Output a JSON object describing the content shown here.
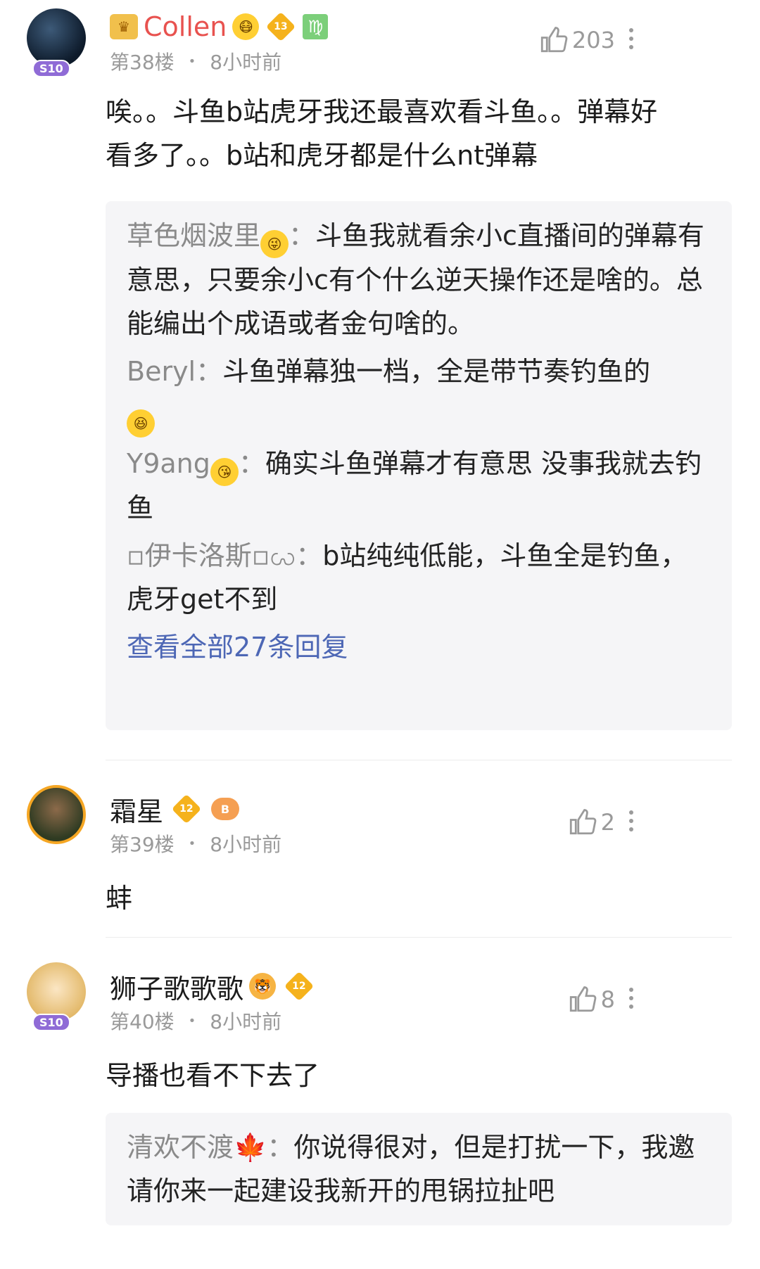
{
  "comments": [
    {
      "user": "Collen",
      "floor": "第38楼",
      "time": "8小时前",
      "likes": "203",
      "level": "13",
      "avatar_badge": "S10",
      "text": "唉。。斗鱼b站虎牙我还最喜欢看斗鱼。。弹幕好看多了。。b站和虎牙都是什么nt弹幕",
      "replies": [
        {
          "name": "草色烟波里",
          "text": "斗鱼我就看余小c直播间的弹幕有意思，只要余小c有个什么逆天操作还是啥的。总能编出个成语或者金句啥的。"
        },
        {
          "name": "Beryl",
          "text": "斗鱼弹幕独一档，全是带节奏钓鱼的"
        },
        {
          "name": "Y9ang",
          "text": "确实斗鱼弹幕才有意思 没事我就去钓鱼"
        },
        {
          "name": "▫伊卡洛斯▫ꩬ",
          "text": "b站纯纯低能，斗鱼全是钓鱼，虎牙get不到"
        }
      ],
      "view_all": "查看全部27条回复"
    },
    {
      "user": "霜星",
      "floor": "第39楼",
      "time": "8小时前",
      "likes": "2",
      "level": "12",
      "text": "蚌"
    },
    {
      "user": "狮子歌歌歌",
      "floor": "第40楼",
      "time": "8小时前",
      "likes": "8",
      "level": "12",
      "avatar_badge": "S10",
      "text": "导播也看不下去了",
      "replies": [
        {
          "name": "清欢不渡",
          "text": "你说得很对，但是打扰一下，我邀请你来一起建设我新开的甩锅拉扯吧"
        }
      ]
    }
  ],
  "separator": "：",
  "colors": {
    "vip_name": "#e8524f",
    "link": "#4d67b5",
    "meta": "#9a9a9a"
  }
}
